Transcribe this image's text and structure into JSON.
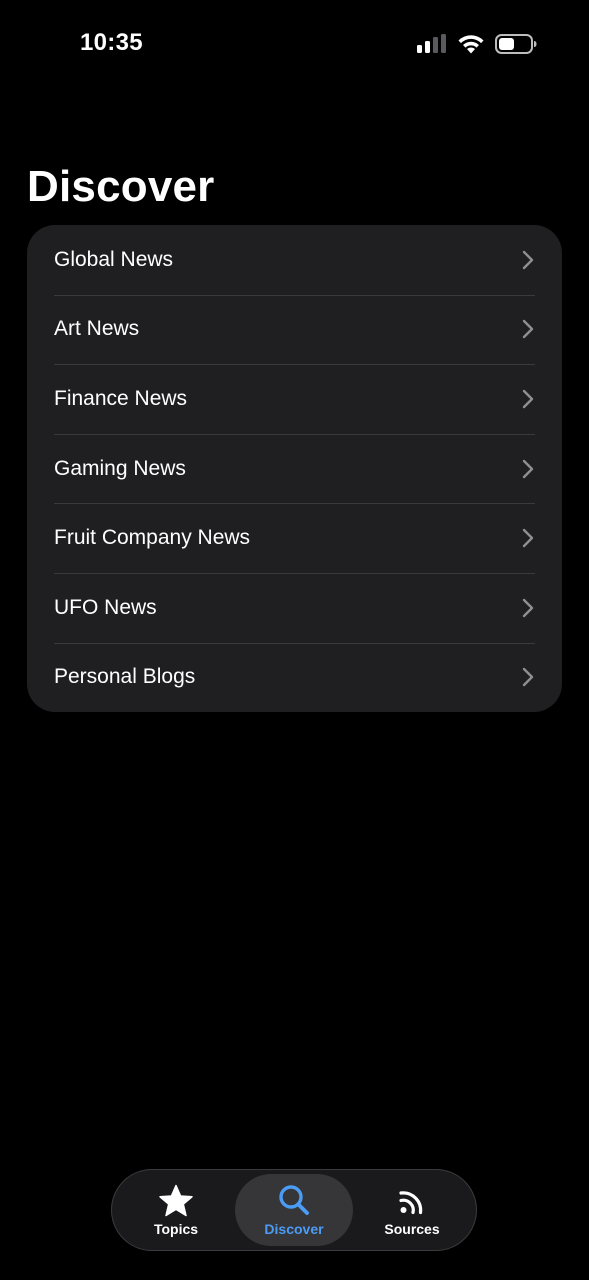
{
  "status_bar": {
    "time": "10:35"
  },
  "page": {
    "title": "Discover"
  },
  "list": {
    "items": [
      {
        "label": "Global News"
      },
      {
        "label": "Art News"
      },
      {
        "label": "Finance News"
      },
      {
        "label": "Gaming News"
      },
      {
        "label": "Fruit Company News"
      },
      {
        "label": "UFO News"
      },
      {
        "label": "Personal Blogs"
      }
    ]
  },
  "tab_bar": {
    "tabs": [
      {
        "label": "Topics",
        "icon": "star-icon",
        "active": false
      },
      {
        "label": "Discover",
        "icon": "search-icon",
        "active": true
      },
      {
        "label": "Sources",
        "icon": "rss-icon",
        "active": false
      }
    ]
  },
  "colors": {
    "background": "#000000",
    "card": "#1f1f21",
    "accent": "#4a9cf5",
    "chevron": "#8e8e93"
  }
}
